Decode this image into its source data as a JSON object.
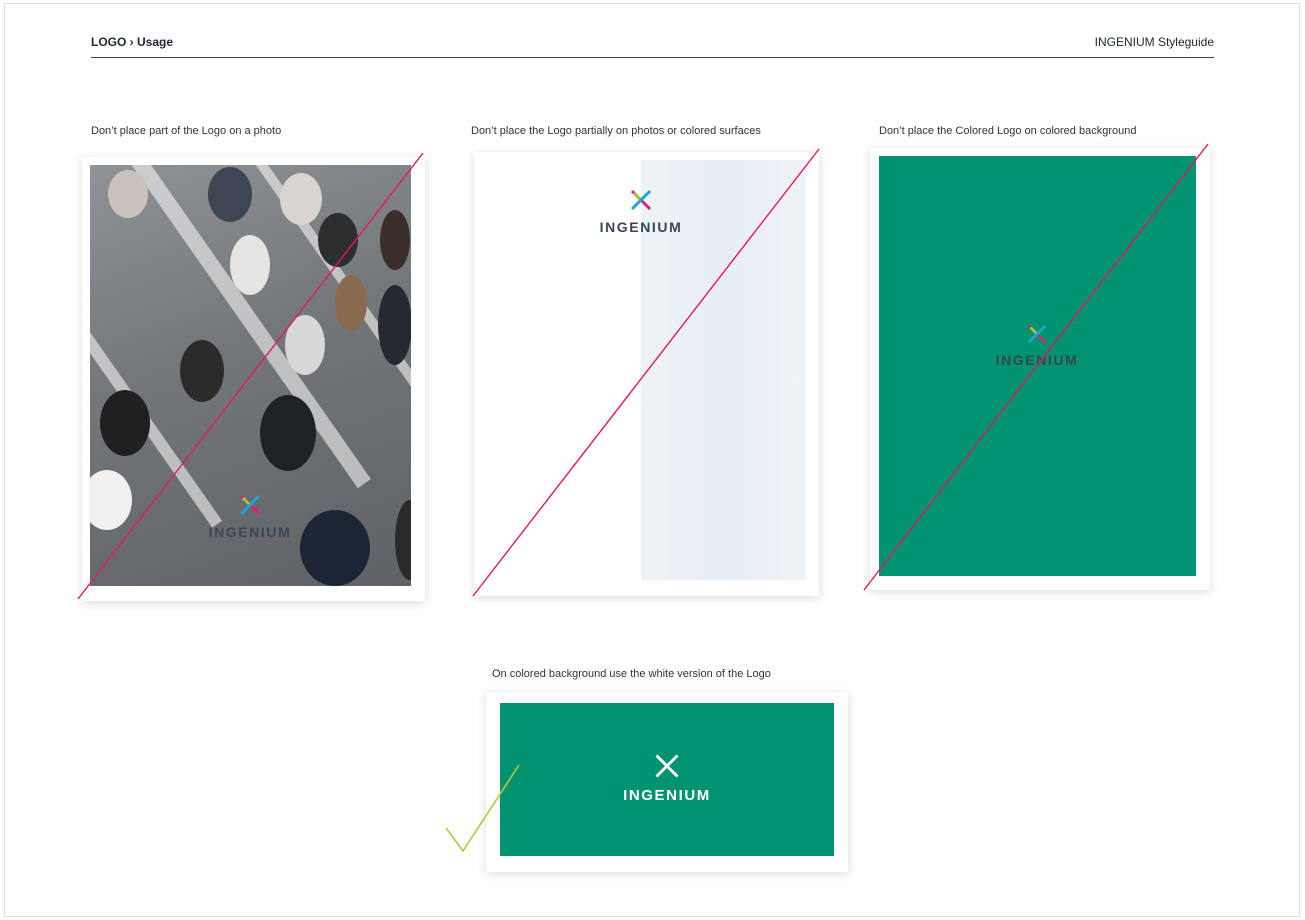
{
  "header": {
    "breadcrumb": "LOGO › Usage",
    "guide_title": "INGENIUM Styleguide"
  },
  "examples": [
    {
      "caption": "Don’t place part of the Logo on a photo",
      "verdict": "dont"
    },
    {
      "caption": "Don’t place the Logo partially on photos or colored surfaces",
      "verdict": "dont"
    },
    {
      "caption": "Don’t place the Colored Logo on colored background",
      "verdict": "dont"
    },
    {
      "caption": "On colored background use the white version of the Logo",
      "verdict": "do"
    }
  ],
  "logo": {
    "wordmark": "INGENIUM"
  },
  "colors": {
    "brand_green": "#00936f",
    "strike_line": "#e4185f",
    "check_mark": "#b5c63a",
    "logo_dark": "#3a4654",
    "logo_cyan": "#1aa7d8",
    "logo_magenta": "#d6247a",
    "logo_lime": "#a6c735"
  },
  "icons": {
    "logo_mark": "ingenium-x-mark",
    "strike": "diagonal-strike-line",
    "approve": "checkmark-icon"
  }
}
